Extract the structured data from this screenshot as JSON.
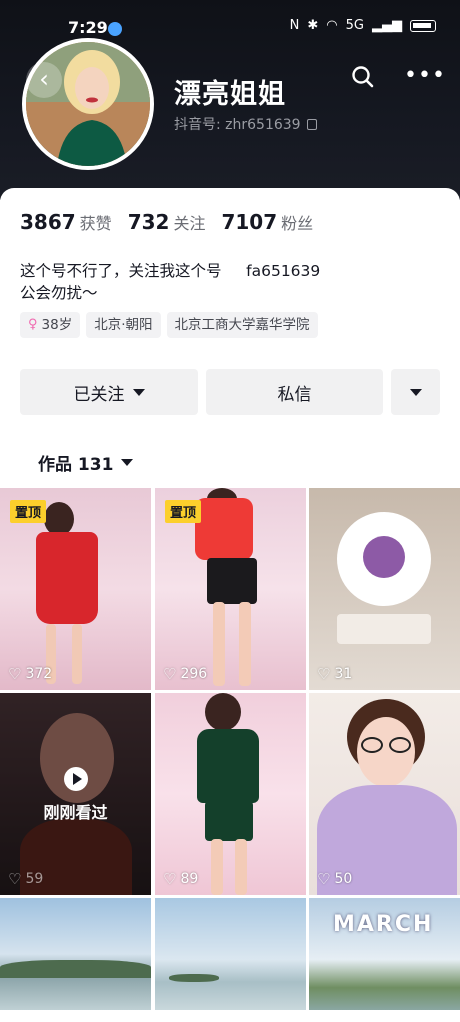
{
  "status_bar": {
    "time": "7:29",
    "signal_label": "5G"
  },
  "profile": {
    "nickname": "漂亮姐姐",
    "douyin_id": "抖音号: zhr651639",
    "stats": [
      {
        "num": "3867",
        "label": "获赞"
      },
      {
        "num": "732",
        "label": "关注"
      },
      {
        "num": "7107",
        "label": "粉丝"
      }
    ],
    "bio_line1": "这个号不行了，关注我这个号     fa651639",
    "bio_line2": "公会勿扰～",
    "tags": [
      "38岁",
      "北京·朝阳",
      "北京工商大学嘉华学院"
    ]
  },
  "actions": {
    "follow": "已关注",
    "message": "私信"
  },
  "works_tab": "作品 131",
  "grid": {
    "pinned_label": "置顶",
    "watched_label": "刚刚看过",
    "items": [
      {
        "likes": "372"
      },
      {
        "likes": "296"
      },
      {
        "likes": "31"
      },
      {
        "likes": "59"
      },
      {
        "likes": "89"
      },
      {
        "likes": "50"
      }
    ],
    "march_title": "MARCH"
  },
  "colors": {
    "accent_pin": "#fccf2c",
    "header_bg": "#0f1117"
  }
}
